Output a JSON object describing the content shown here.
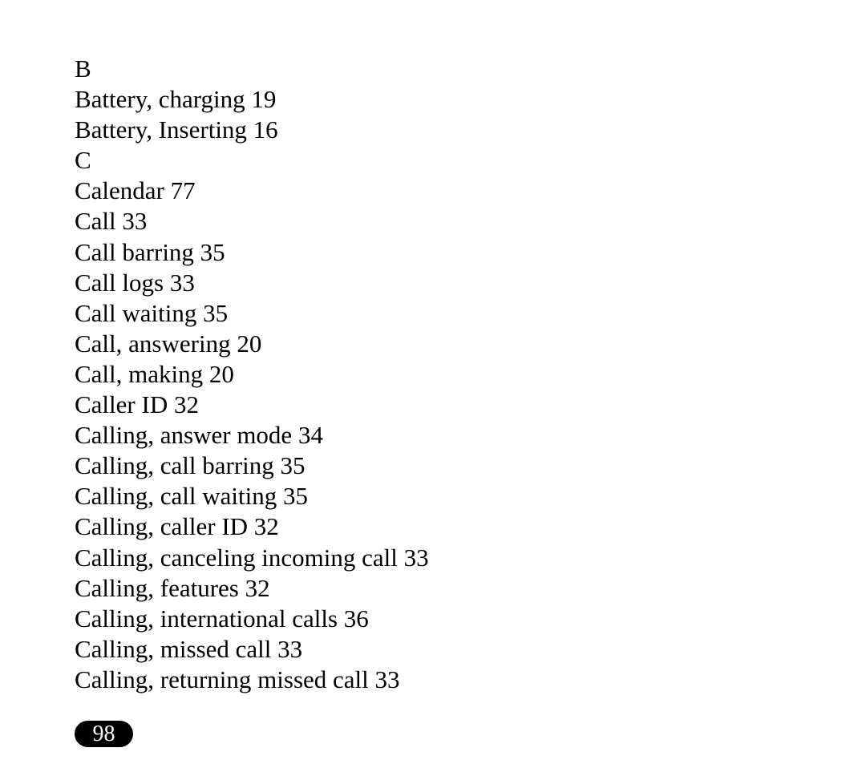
{
  "index": {
    "lines": [
      {
        "type": "letter",
        "text": "B"
      },
      {
        "type": "entry",
        "text": "Battery, charging 19"
      },
      {
        "type": "entry",
        "text": "Battery, Inserting 16"
      },
      {
        "type": "letter",
        "text": "C"
      },
      {
        "type": "entry",
        "text": "Calendar 77"
      },
      {
        "type": "entry",
        "text": "Call 33"
      },
      {
        "type": "entry",
        "text": "Call barring 35"
      },
      {
        "type": "entry",
        "text": "Call logs 33"
      },
      {
        "type": "entry",
        "text": "Call waiting 35"
      },
      {
        "type": "entry",
        "text": "Call, answering 20"
      },
      {
        "type": "entry",
        "text": "Call, making 20"
      },
      {
        "type": "entry",
        "text": "Caller ID 32"
      },
      {
        "type": "entry",
        "text": "Calling, answer mode 34"
      },
      {
        "type": "entry",
        "text": "Calling, call barring 35"
      },
      {
        "type": "entry",
        "text": "Calling, call waiting 35"
      },
      {
        "type": "entry",
        "text": "Calling, caller ID 32"
      },
      {
        "type": "entry",
        "text": "Calling, canceling incoming call 33"
      },
      {
        "type": "entry",
        "text": "Calling, features 32"
      },
      {
        "type": "entry",
        "text": "Calling, international calls 36"
      },
      {
        "type": "entry",
        "text": "Calling, missed call 33"
      },
      {
        "type": "entry",
        "text": "Calling, returning missed call 33"
      }
    ]
  },
  "page_number": "98"
}
